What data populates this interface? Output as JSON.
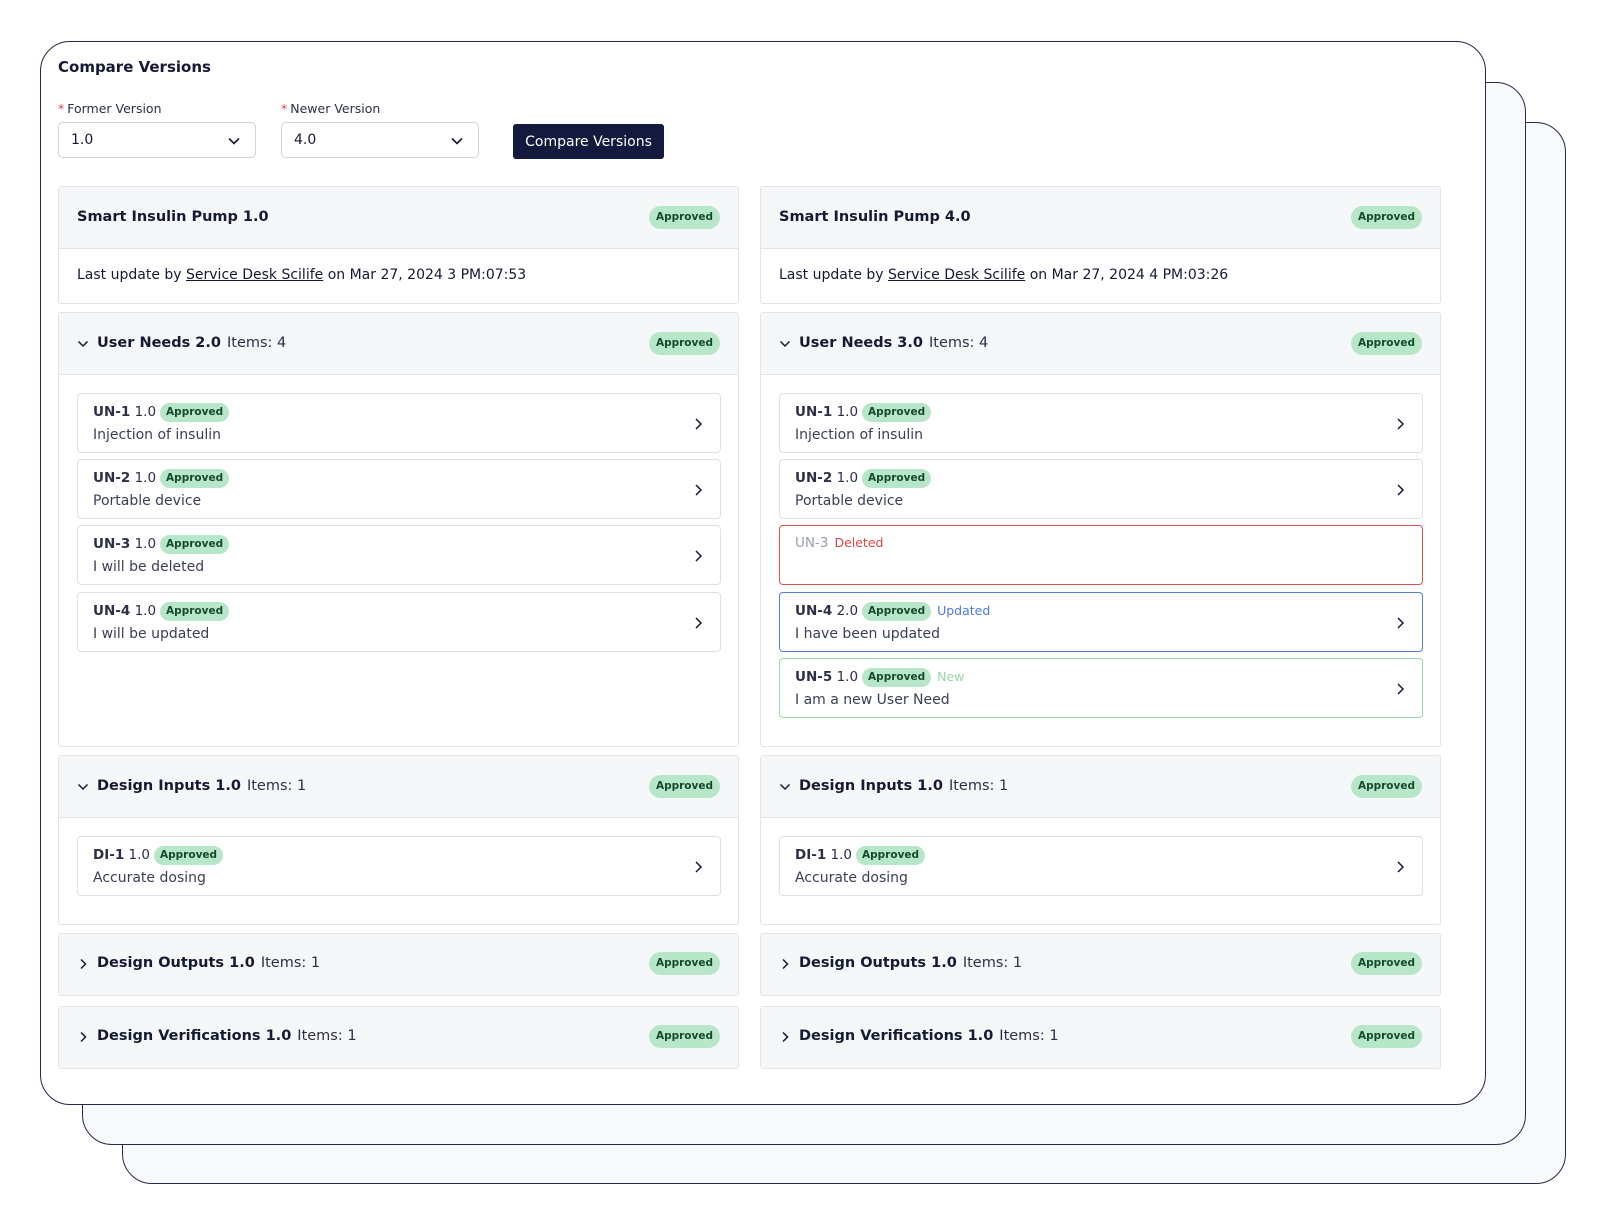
{
  "page_title": "Compare Versions",
  "former_version": {
    "label": "Former Version",
    "value": "1.0"
  },
  "newer_version": {
    "label": "Newer Version",
    "value": "4.0"
  },
  "compare_button": "Compare Versions",
  "left": {
    "product": "Smart Insulin Pump 1.0",
    "product_status": "Approved",
    "updated_prefix": "Last update by",
    "updated_by": "Service Desk Scilife",
    "updated_on": "on Mar 27, 2024 3 PM:07:53",
    "user_needs": {
      "title": "User Needs 2.0",
      "count": "Items: 4",
      "status": "Approved",
      "items": [
        {
          "id": "UN-1",
          "version": "1.0",
          "status": "Approved",
          "text": "Injection of insulin"
        },
        {
          "id": "UN-2",
          "version": "1.0",
          "status": "Approved",
          "text": "Portable device"
        },
        {
          "id": "UN-3",
          "version": "1.0",
          "status": "Approved",
          "text": "I will be deleted"
        },
        {
          "id": "UN-4",
          "version": "1.0",
          "status": "Approved",
          "text": "I will be updated"
        }
      ]
    },
    "design_inputs": {
      "title": "Design Inputs 1.0",
      "count": "Items: 1",
      "status": "Approved",
      "items": [
        {
          "id": "DI-1",
          "version": "1.0",
          "status": "Approved",
          "text": "Accurate dosing"
        }
      ]
    },
    "design_outputs": {
      "title": "Design Outputs 1.0",
      "count": "Items: 1",
      "status": "Approved"
    },
    "design_verifications": {
      "title": "Design Verifications 1.0",
      "count": "Items: 1",
      "status": "Approved"
    }
  },
  "right": {
    "product": "Smart Insulin Pump 4.0",
    "product_status": "Approved",
    "updated_prefix": "Last update by",
    "updated_by": "Service Desk Scilife",
    "updated_on": "on Mar 27, 2024 4 PM:03:26",
    "user_needs": {
      "title": "User Needs 3.0",
      "count": "Items: 4",
      "status": "Approved",
      "items": [
        {
          "id": "UN-1",
          "version": "1.0",
          "status": "Approved",
          "text": "Injection of insulin"
        },
        {
          "id": "UN-2",
          "version": "1.0",
          "status": "Approved",
          "text": "Portable device"
        },
        {
          "id": "UN-3",
          "change": "Deleted"
        },
        {
          "id": "UN-4",
          "version": "2.0",
          "status": "Approved",
          "change": "Updated",
          "text": "I have been updated"
        },
        {
          "id": "UN-5",
          "version": "1.0",
          "status": "Approved",
          "change": "New",
          "text": "I am a new User Need"
        }
      ]
    },
    "design_inputs": {
      "title": "Design Inputs 1.0",
      "count": "Items: 1",
      "status": "Approved",
      "items": [
        {
          "id": "DI-1",
          "version": "1.0",
          "status": "Approved",
          "text": "Accurate dosing"
        }
      ]
    },
    "design_outputs": {
      "title": "Design Outputs 1.0",
      "count": "Items: 1",
      "status": "Approved"
    },
    "design_verifications": {
      "title": "Design Verifications 1.0",
      "count": "Items: 1",
      "status": "Approved"
    }
  },
  "icons": {
    "dropdown": "chevron-down-icon",
    "expanded": "caret-down-icon",
    "collapsed": "caret-right-icon",
    "open_item": "chevron-right-icon"
  }
}
